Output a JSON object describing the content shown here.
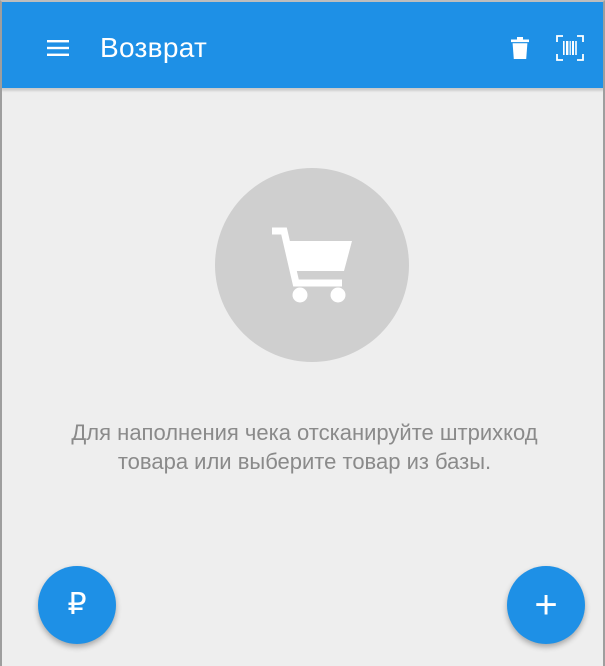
{
  "app": {
    "title": "Возврат",
    "accent_color": "#1e90e6",
    "background_color": "#eeeeee"
  },
  "toolbar": {
    "menu_icon": "hamburger-menu-icon",
    "delete_icon": "trash-icon",
    "scan_icon": "barcode-scan-icon"
  },
  "empty_state": {
    "icon": "shopping-cart-icon",
    "message": "Для наполнения чека отсканируйте штрихкод товара или выберите товар из базы."
  },
  "fabs": {
    "pay_label": "₽",
    "add_label": "+"
  }
}
